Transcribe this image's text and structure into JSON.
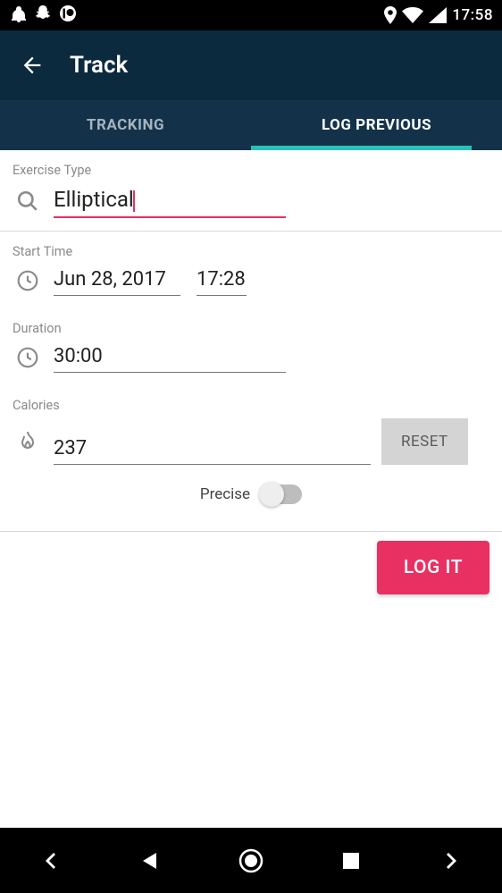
{
  "status": {
    "time": "17:58"
  },
  "header": {
    "title": "Track"
  },
  "tabs": [
    {
      "label": "TRACKING",
      "active": false
    },
    {
      "label": "LOG PREVIOUS",
      "active": true
    }
  ],
  "form": {
    "exercise_type_label": "Exercise Type",
    "exercise_type_value": "Elliptical",
    "start_time_label": "Start Time",
    "start_date_value": "Jun 28, 2017",
    "start_time_value": "17:28",
    "duration_label": "Duration",
    "duration_value": "30:00",
    "calories_label": "Calories",
    "calories_value": "237",
    "reset_label": "RESET",
    "precise_label": "Precise",
    "precise_on": false,
    "log_it_label": "LOG IT"
  },
  "colors": {
    "accent_pink": "#e83062",
    "accent_teal": "#29c2b9",
    "header_bg": "#0b2a3e",
    "tabs_bg": "#13324a"
  }
}
